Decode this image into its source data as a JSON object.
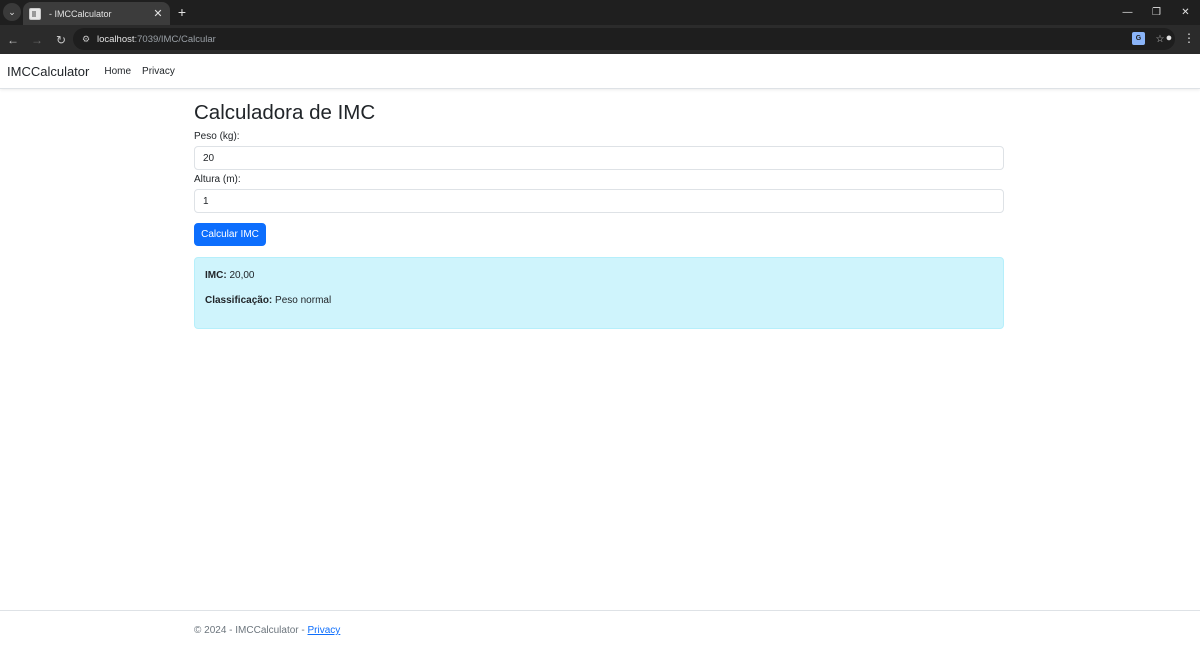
{
  "browser": {
    "tab_title": "- IMCCalculator",
    "tab_close": "✕",
    "new_tab": "+",
    "url_host": "localhost",
    "url_path": ":7039/IMC/Calcular",
    "window_controls": {
      "minimize": "—",
      "restore": "❐",
      "close": "✕"
    }
  },
  "site": {
    "brand": "IMCCalculator",
    "nav": [
      {
        "label": "Home"
      },
      {
        "label": "Privacy"
      }
    ]
  },
  "form": {
    "title": "Calculadora de IMC",
    "peso_label": "Peso (kg):",
    "peso_value": "20",
    "altura_label": "Altura (m):",
    "altura_value": "1",
    "submit_label": "Calcular IMC"
  },
  "result": {
    "imc_label": "IMC:",
    "imc_value": "20,00",
    "class_label": "Classificação:",
    "class_value": "Peso normal"
  },
  "footer": {
    "text": "© 2024 - IMCCalculator - ",
    "link": "Privacy"
  },
  "colors": {
    "primary": "#0d6efd",
    "alert_bg": "#cff4fc",
    "chrome_dark": "#1f1f1f"
  }
}
